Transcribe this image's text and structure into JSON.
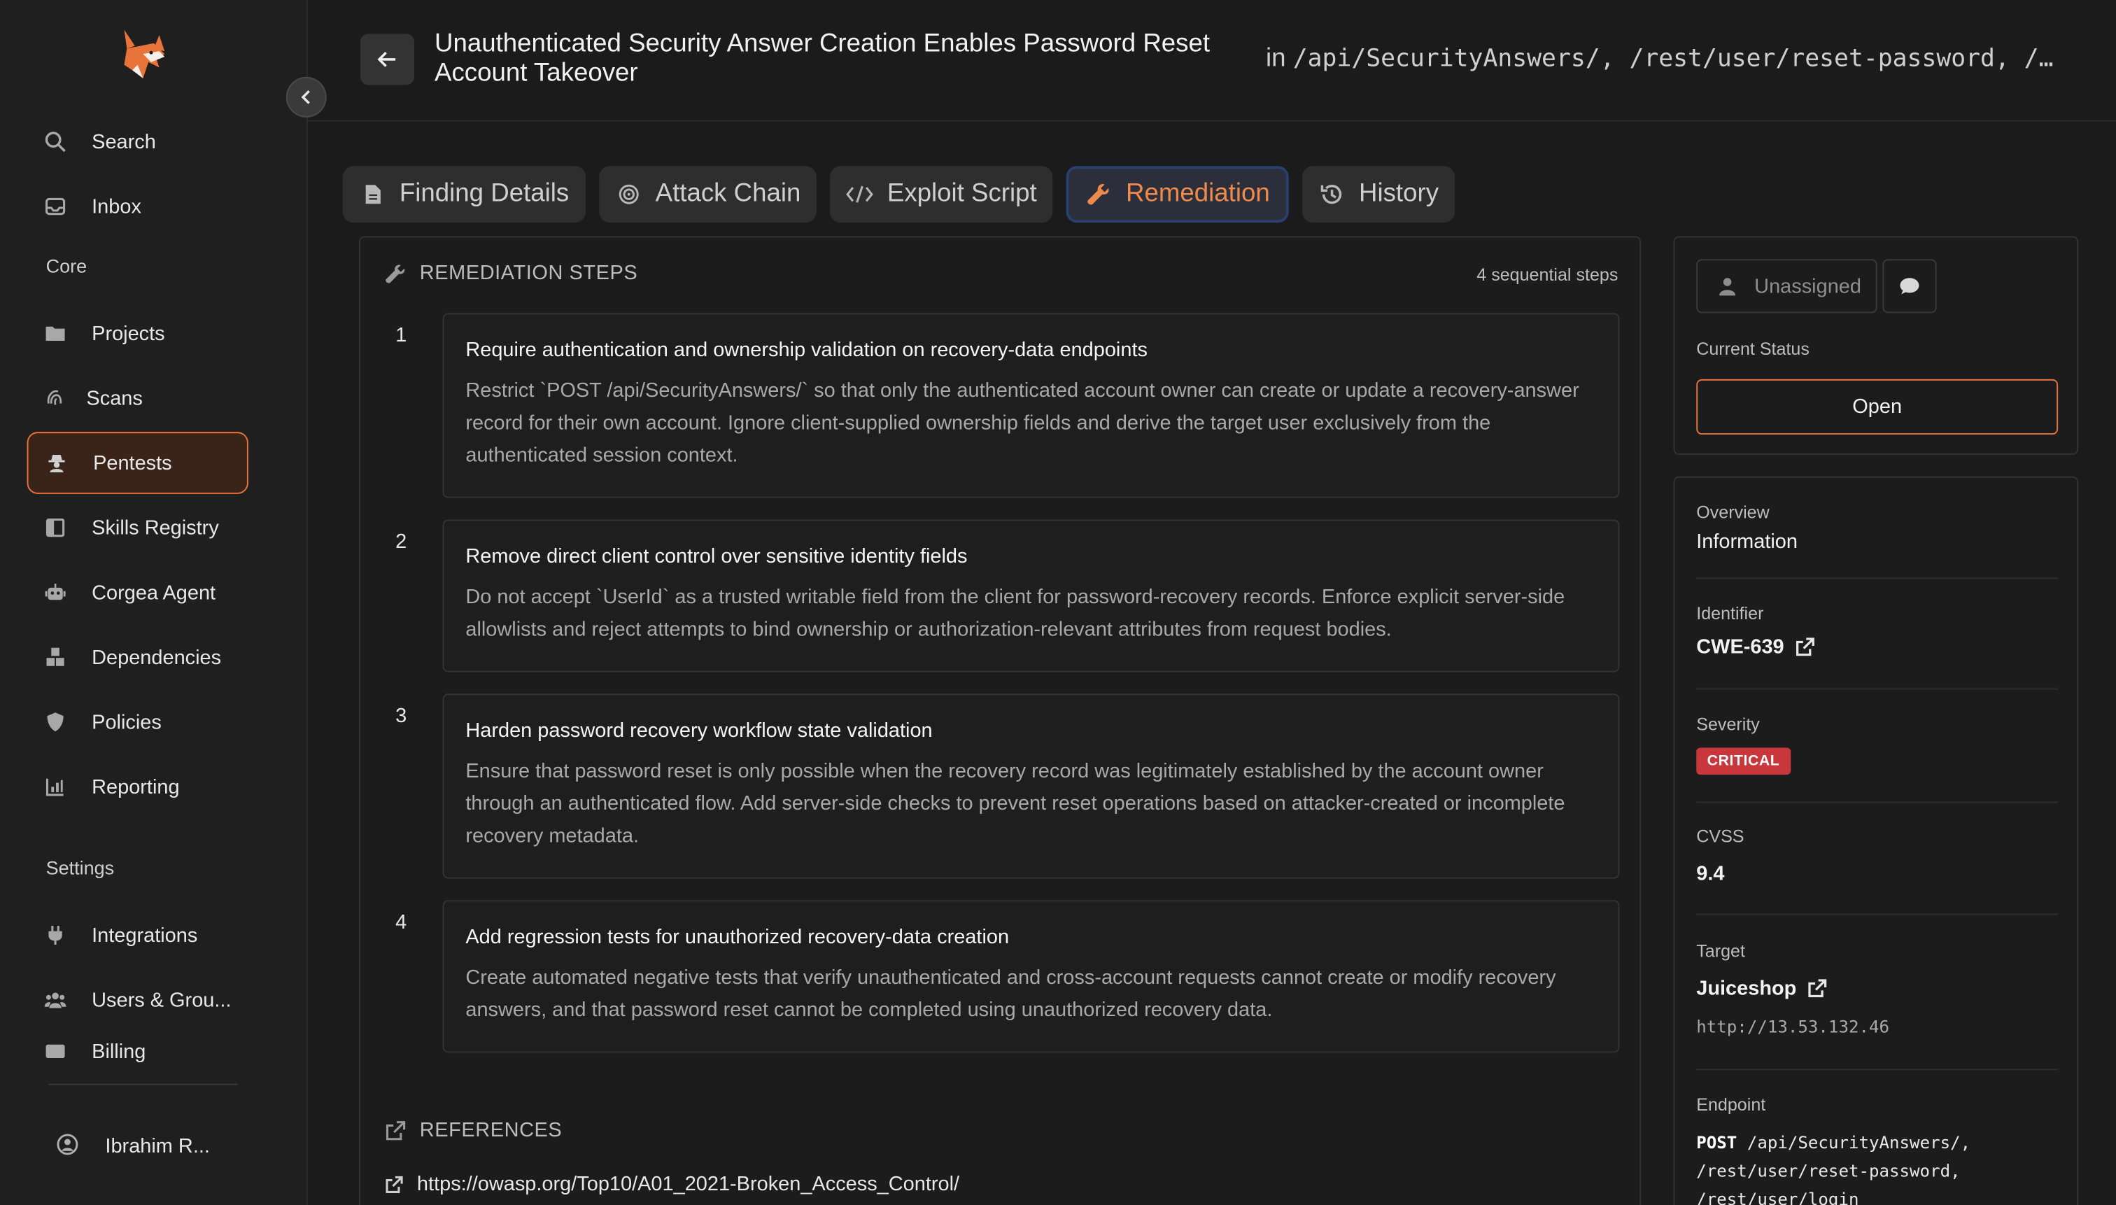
{
  "sidebar": {
    "collapse_icon": "chevron-left-icon",
    "items": [
      {
        "label": "Search",
        "icon": "search-icon"
      },
      {
        "label": "Inbox",
        "icon": "inbox-icon"
      }
    ],
    "core_label": "Core",
    "core_items": [
      {
        "label": "Projects",
        "icon": "folder-icon"
      },
      {
        "label": "Scans",
        "icon": "fingerprint-icon"
      },
      {
        "label": "Pentests",
        "icon": "spy-icon"
      },
      {
        "label": "Skills Registry",
        "icon": "book-icon"
      },
      {
        "label": "Corgea Agent",
        "icon": "robot-icon"
      },
      {
        "label": "Dependencies",
        "icon": "cubes-icon"
      },
      {
        "label": "Policies",
        "icon": "shield-icon"
      },
      {
        "label": "Reporting",
        "icon": "chart-icon"
      }
    ],
    "settings_label": "Settings",
    "settings_items": [
      {
        "label": "Integrations",
        "icon": "plug-icon"
      },
      {
        "label": "Users & Grou...",
        "icon": "users-icon"
      },
      {
        "label": "Billing",
        "icon": "card-icon"
      }
    ],
    "user_name": "Ibrahim R..."
  },
  "header": {
    "title": "Unauthenticated Security Answer Creation Enables Password Reset Account Takeover",
    "location_prefix": "in",
    "location": "/api/SecurityAnswers/, /rest/user/reset-password, /…"
  },
  "tabs": [
    {
      "label": "Finding Details",
      "icon": "file-icon"
    },
    {
      "label": "Attack Chain",
      "icon": "target-icon"
    },
    {
      "label": "Exploit Script",
      "icon": "code-icon"
    },
    {
      "label": "Remediation",
      "icon": "wrench-icon"
    },
    {
      "label": "History",
      "icon": "history-icon"
    }
  ],
  "remediation": {
    "heading": "REMEDIATION STEPS",
    "count": "4 sequential steps",
    "steps": [
      {
        "num": "1",
        "title": "Require authentication and ownership validation on recovery-data endpoints",
        "body": "Restrict `POST /api/SecurityAnswers/` so that only the authenticated account owner can create or update a recovery-answer record for their own account. Ignore client-supplied ownership fields and derive the target user exclusively from the authenticated session context."
      },
      {
        "num": "2",
        "title": "Remove direct client control over sensitive identity fields",
        "body": "Do not accept `UserId` as a trusted writable field from the client for password-recovery records. Enforce explicit server-side allowlists and reject attempts to bind ownership or authorization-relevant attributes from request bodies."
      },
      {
        "num": "3",
        "title": "Harden password recovery workflow state validation",
        "body": "Ensure that password reset is only possible when the recovery record was legitimately established by the account owner through an authenticated flow. Add server-side checks to prevent reset operations based on attacker-created or incomplete recovery metadata."
      },
      {
        "num": "4",
        "title": "Add regression tests for unauthorized recovery-data creation",
        "body": "Create automated negative tests that verify unauthenticated and cross-account requests cannot create or modify recovery answers, and that password reset cannot be completed using unauthorized recovery data."
      }
    ],
    "references_heading": "REFERENCES",
    "references": [
      "https://owasp.org/Top10/A01_2021-Broken_Access_Control/"
    ]
  },
  "right": {
    "assignee": "Unassigned",
    "status_label": "Current Status",
    "status_value": "Open",
    "overview_label": "Overview",
    "overview_value": "Information",
    "identifier_label": "Identifier",
    "identifier_value": "CWE-639",
    "severity_label": "Severity",
    "severity_value": "CRITICAL",
    "cvss_label": "CVSS",
    "cvss_value": "9.4",
    "target_label": "Target",
    "target_value": "Juiceshop",
    "target_url": "http://13.53.132.46",
    "endpoint_label": "Endpoint",
    "endpoint_method": "POST",
    "endpoint_line1": " /api/SecurityAnswers/,",
    "endpoint_line2": "/rest/user/reset-password,",
    "endpoint_line3": "/rest/user/login"
  },
  "colors": {
    "accent": "#e8743b",
    "critical": "#c9373d",
    "active_tab_border": "#27406e"
  }
}
